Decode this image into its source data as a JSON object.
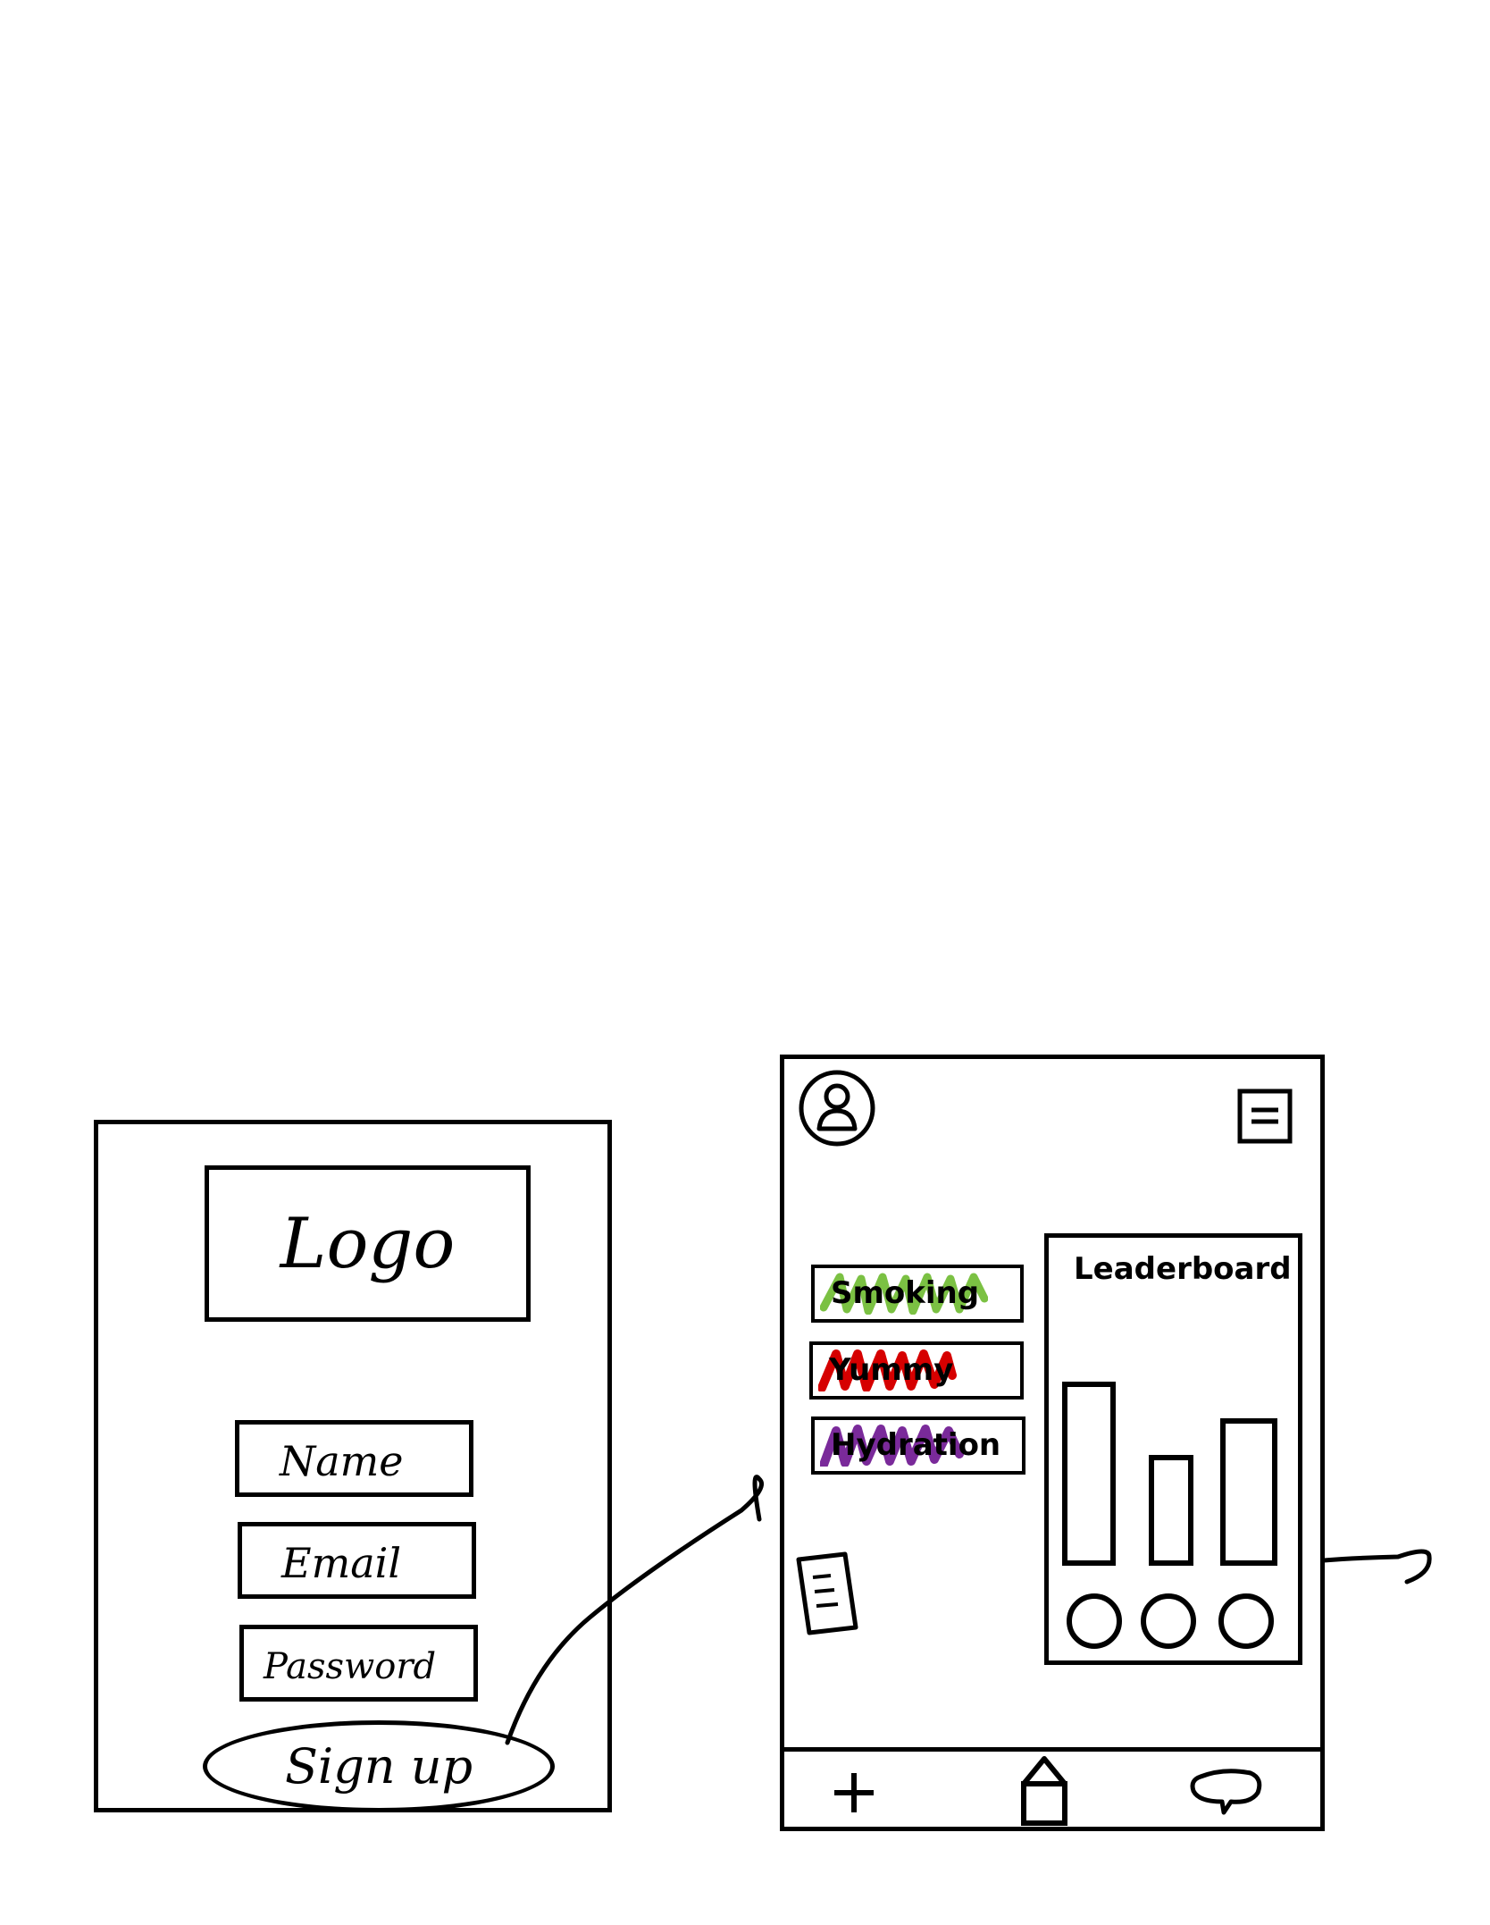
{
  "signup_screen": {
    "logo": "Logo",
    "fields": [
      {
        "label": "Name"
      },
      {
        "label": "Email"
      },
      {
        "label": "Password"
      }
    ],
    "signup_button": "Sign up"
  },
  "home_screen": {
    "header": {
      "profile_icon": "profile-icon",
      "menu_icon": "menu-icon"
    },
    "habits": [
      {
        "label": "Smoking",
        "color": "#7bc143"
      },
      {
        "label": "Yummy",
        "color": "#d60000"
      },
      {
        "label": "Hydration",
        "color": "#7a2a9a"
      }
    ],
    "notes_icon": "notes-icon",
    "leaderboard": {
      "title": "Leaderboard",
      "bar_levels": [
        1.0,
        0.6,
        0.8
      ]
    },
    "bottom_nav": [
      {
        "icon": "plus-icon"
      },
      {
        "icon": "home-icon"
      },
      {
        "icon": "chat-icon"
      }
    ]
  }
}
